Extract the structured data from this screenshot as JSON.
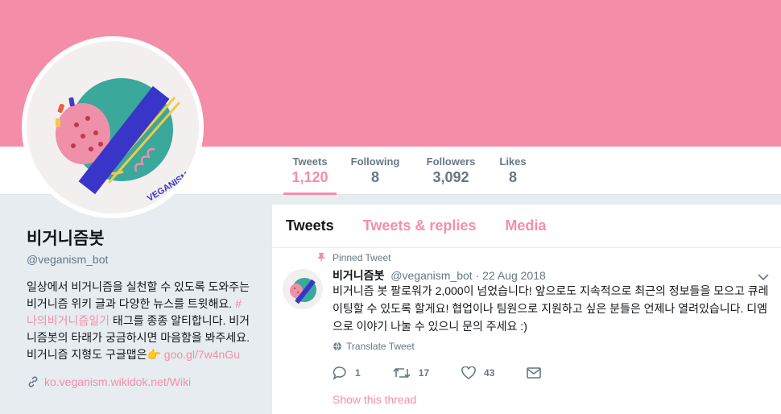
{
  "colors": {
    "accent": "#f48ea8",
    "banner": "#f48ea8",
    "muted": "#657786"
  },
  "avatar_logo_text": "VEGANISM BOT",
  "nav": {
    "stats": [
      {
        "label": "Tweets",
        "value": "1,120"
      },
      {
        "label": "Following",
        "value": "8"
      },
      {
        "label": "Followers",
        "value": "3,092"
      },
      {
        "label": "Likes",
        "value": "8"
      }
    ]
  },
  "profile": {
    "name": "비거니즘봇",
    "handle": "@veganism_bot",
    "bio_part1": "일상에서 비거니즘을 실천할 수 있도록 도와주는 비거니즘 위키 글과 다양한 뉴스를 트윗해요. ",
    "bio_hashtag": "#나의비거니즘일기",
    "bio_part2": " 태그를 종종 알티합니다. 비거니즘봇의 타래가 궁금하시면 마음함을 봐주세요. 비거니즘 지형도 구글맵은",
    "bio_emoji": "👉",
    "bio_link": "goo.gl/7w4nGu",
    "url": "ko.veganism.wikidok.net/Wiki"
  },
  "timeline": {
    "tabs": [
      "Tweets",
      "Tweets & replies",
      "Media"
    ],
    "tweet": {
      "pinned_label": "Pinned Tweet",
      "author_name": "비거니즘봇",
      "author_handle": "@veganism_bot",
      "date": "· 22 Aug 2018",
      "text": "비거니즘 봇 팔로워가 2,000이 넘었습니다! 앞으로도 지속적으로 최근의 정보들을 모으고 큐레이팅할 수 있도록 할게요! 협업이나 팀원으로 지원하고 싶은 분들은 언제나 열려있습니다. 디엠으로 이야기 나눌 수 있으니 문의 주세요 :)",
      "translate_label": "Translate Tweet",
      "replies": "1",
      "retweets": "17",
      "likes": "43",
      "show_thread": "Show this thread"
    }
  }
}
